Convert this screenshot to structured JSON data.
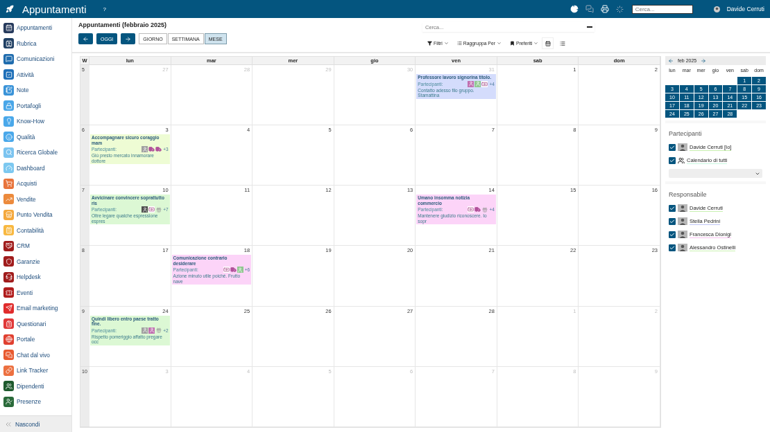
{
  "topbar": {
    "title": "Appuntamenti",
    "help": "?",
    "search": {
      "placeholder": "Cerca..."
    },
    "user": "Davide Cerruti"
  },
  "sidebar": {
    "items": [
      {
        "label": "Appuntamenti",
        "color": "#263a5c"
      },
      {
        "label": "Rubrica",
        "color": "#1f3f63"
      },
      {
        "label": "Comunicazioni",
        "color": "#1f6cae"
      },
      {
        "label": "Attività",
        "color": "#1e6fb8"
      },
      {
        "label": "Note",
        "color": "#3a93d8"
      },
      {
        "label": "Portafogli",
        "color": "#49a6e8"
      },
      {
        "label": "Know-How",
        "color": "#4aa8ea"
      },
      {
        "label": "Qualità",
        "color": "#4aa8ea"
      },
      {
        "label": "Ricerca Globale",
        "color": "#7cc4f0"
      },
      {
        "label": "Dashboard",
        "color": "#7cc8f0"
      },
      {
        "label": "Acquisti",
        "color": "#e8743c"
      },
      {
        "label": "Vendite",
        "color": "#ec8a3c"
      },
      {
        "label": "Punto Vendita",
        "color": "#f4a83c"
      },
      {
        "label": "Contabilità",
        "color": "#f8b840"
      },
      {
        "label": "CRM",
        "color": "#a01c1c"
      },
      {
        "label": "Garanzie",
        "color": "#a01c1c"
      },
      {
        "label": "Helpdesk",
        "color": "#a01c1c"
      },
      {
        "label": "Eventi",
        "color": "#b01c1c"
      },
      {
        "label": "Email marketing",
        "color": "#e02c2c"
      },
      {
        "label": "Questionari",
        "color": "#e03838"
      },
      {
        "label": "Portale",
        "color": "#e04030"
      },
      {
        "label": "Chat dal vivo",
        "color": "#e85a30"
      },
      {
        "label": "Link Tracker",
        "color": "#ec7040"
      },
      {
        "label": "Dipendenti",
        "color": "#1e5a2e"
      },
      {
        "label": "Presenze",
        "color": "#2a6a3a"
      }
    ],
    "hide": "Nascondi"
  },
  "header": {
    "title": "Appuntamenti (febbraio 2025)",
    "search": {
      "placeholder": "Cerca..."
    },
    "today": "OGGI",
    "views": [
      {
        "label": "GIORNO",
        "selected": false
      },
      {
        "label": "SETTIMANA",
        "selected": false
      },
      {
        "label": "MESE",
        "selected": true
      }
    ],
    "filters": [
      {
        "label": "Filtri",
        "kind": "filter"
      },
      {
        "label": "Raggruppa Per",
        "kind": "group"
      },
      {
        "label": "Preferiti",
        "kind": "bookmark"
      }
    ],
    "modes": [
      {
        "kind": "calendar",
        "selected": true
      },
      {
        "kind": "list",
        "selected": false
      }
    ]
  },
  "calendar": {
    "week_label": "W",
    "weekdays": [
      "lun",
      "mar",
      "mer",
      "gio",
      "ven",
      "sab",
      "dom"
    ],
    "weeks": [
      {
        "week": "5",
        "days": [
          {
            "day": "27",
            "other_month": true
          },
          {
            "day": "28",
            "other_month": true
          },
          {
            "day": "29",
            "other_month": true
          },
          {
            "day": "30",
            "other_month": true
          },
          {
            "day": "31",
            "other_month": true,
            "events": [
              {
                "title": "Professore lavoro signorina titolo.",
                "color": "#d4dcfc",
                "participants_label": "Partecipanti:",
                "participants": [
                  {
                    "kind": "avatar",
                    "color": "#c070b0"
                  },
                  {
                    "kind": "avatar",
                    "color": "#90c890"
                  },
                  {
                    "kind": "banknote"
                  }
                ],
                "more": "+4",
                "description": "Contatto adesso filo gruppo. Stamattina"
              }
            ]
          },
          {
            "day": "1",
            "other_month": false
          },
          {
            "day": "2",
            "other_month": false
          }
        ]
      },
      {
        "week": "6",
        "days": [
          {
            "day": "3",
            "other_month": false,
            "events": [
              {
                "title": "Accompagnare sicuro coraggio mam",
                "color": "#eefcd4",
                "participants_label": "Partecipanti:",
                "participants": [
                  {
                    "kind": "avatar",
                    "color": "#a0a0a0"
                  },
                  {
                    "kind": "truck"
                  },
                  {
                    "kind": "truck"
                  }
                ],
                "more": "+3",
                "description": "Giù presto mercato innamorare dottore"
              }
            ]
          },
          {
            "day": "4",
            "other_month": false
          },
          {
            "day": "5",
            "other_month": false
          },
          {
            "day": "6",
            "other_month": false
          },
          {
            "day": "7",
            "other_month": false
          },
          {
            "day": "8",
            "other_month": false
          },
          {
            "day": "9",
            "other_month": false
          }
        ]
      },
      {
        "week": "7",
        "days": [
          {
            "day": "10",
            "other_month": false,
            "events": [
              {
                "title": "Avvicinare convincere soprattutto ris",
                "color": "#dcf8d4",
                "participants_label": "Partecipanti:",
                "participants": [
                  {
                    "kind": "avatar",
                    "color": "#505050"
                  },
                  {
                    "kind": "banknote"
                  },
                  {
                    "kind": "gift"
                  }
                ],
                "more": "+7",
                "description": "Oltre legare qualche espressione espres"
              }
            ]
          },
          {
            "day": "11",
            "other_month": false
          },
          {
            "day": "12",
            "other_month": false
          },
          {
            "day": "13",
            "other_month": false
          },
          {
            "day": "14",
            "other_month": false,
            "events": [
              {
                "title": "Umano insomma notizia commercio",
                "color": "#fcd4f8",
                "participants_label": "Partecipanti:",
                "participants": [
                  {
                    "kind": "banknote"
                  },
                  {
                    "kind": "truck"
                  },
                  {
                    "kind": "gift"
                  }
                ],
                "more": "+4",
                "description": "Mantenere giudizio riconoscere. Io sopr"
              }
            ]
          },
          {
            "day": "15",
            "other_month": false
          },
          {
            "day": "16",
            "other_month": false
          }
        ]
      },
      {
        "week": "8",
        "days": [
          {
            "day": "17",
            "other_month": false
          },
          {
            "day": "18",
            "other_month": false,
            "events": [
              {
                "title": "Comunicazione contrario desiderare",
                "color": "#fcd4f8",
                "participants_label": "Partecipanti:",
                "participants": [
                  {
                    "kind": "banknote"
                  },
                  {
                    "kind": "truck"
                  },
                  {
                    "kind": "avatar",
                    "color": "#90c890"
                  }
                ],
                "more": "+6",
                "description": "Azione minuto utile poiché. Frutto nave"
              }
            ]
          },
          {
            "day": "19",
            "other_month": false
          },
          {
            "day": "20",
            "other_month": false
          },
          {
            "day": "21",
            "other_month": false
          },
          {
            "day": "22",
            "other_month": false
          },
          {
            "day": "23",
            "other_month": false
          }
        ]
      },
      {
        "week": "9",
        "days": [
          {
            "day": "24",
            "other_month": false,
            "events": [
              {
                "title": "Quindi libero entro paese tratto fine.",
                "color": "#dcf8d4",
                "participants_label": "Partecipanti:",
                "participants": [
                  {
                    "kind": "avatar",
                    "color": "#a0a0a0"
                  },
                  {
                    "kind": "avatar",
                    "color": "#c070b0"
                  },
                  {
                    "kind": "gift"
                  }
                ],
                "more": "+2",
                "description": "Rispetto pomeriggio affatto pregare occ"
              }
            ]
          },
          {
            "day": "25",
            "other_month": false
          },
          {
            "day": "26",
            "other_month": false
          },
          {
            "day": "27",
            "other_month": false
          },
          {
            "day": "28",
            "other_month": false
          },
          {
            "day": "1",
            "other_month": true
          },
          {
            "day": "2",
            "other_month": true
          }
        ]
      },
      {
        "week": "10",
        "days": [
          {
            "day": "3",
            "other_month": true
          },
          {
            "day": "4",
            "other_month": true
          },
          {
            "day": "5",
            "other_month": true
          },
          {
            "day": "6",
            "other_month": true
          },
          {
            "day": "7",
            "other_month": true
          },
          {
            "day": "8",
            "other_month": true
          },
          {
            "day": "9",
            "other_month": true
          }
        ]
      }
    ]
  },
  "mini_calendar": {
    "title": "feb 2025",
    "weekdays": [
      "lun",
      "mar",
      "mer",
      "gio",
      "ven",
      "sab",
      "dom"
    ],
    "weeks": [
      [
        "1",
        "2"
      ],
      [
        "3",
        "4",
        "5",
        "6",
        "7",
        "8",
        "9"
      ],
      [
        "10",
        "11",
        "12",
        "13",
        "14",
        "15",
        "16"
      ],
      [
        "17",
        "18",
        "19",
        "20",
        "21",
        "22",
        "23"
      ],
      [
        "24",
        "25",
        "26",
        "27",
        "28"
      ]
    ]
  },
  "participants": {
    "title": "Partecipanti",
    "items": [
      {
        "label": "Davide Cerruti [Io]",
        "kind": "avatar",
        "checked": true,
        "color": "#c8f0b0"
      },
      {
        "label": "Calendario di tutti",
        "kind": "group",
        "checked": true,
        "color": "#c8f8e0"
      }
    ]
  },
  "responsible": {
    "title": "Responsabile",
    "items": [
      {
        "label": "Davide Cerruti",
        "checked": true,
        "color": "#c8f0b0"
      },
      {
        "label": "Stella Pedrini",
        "checked": true,
        "color": "#c0c8f8"
      },
      {
        "label": "Francesca Dionigi",
        "checked": true,
        "color": "#f8c0f0"
      },
      {
        "label": "Alessandro Ostinelli",
        "checked": true,
        "color": "#c8f0b0"
      }
    ]
  }
}
